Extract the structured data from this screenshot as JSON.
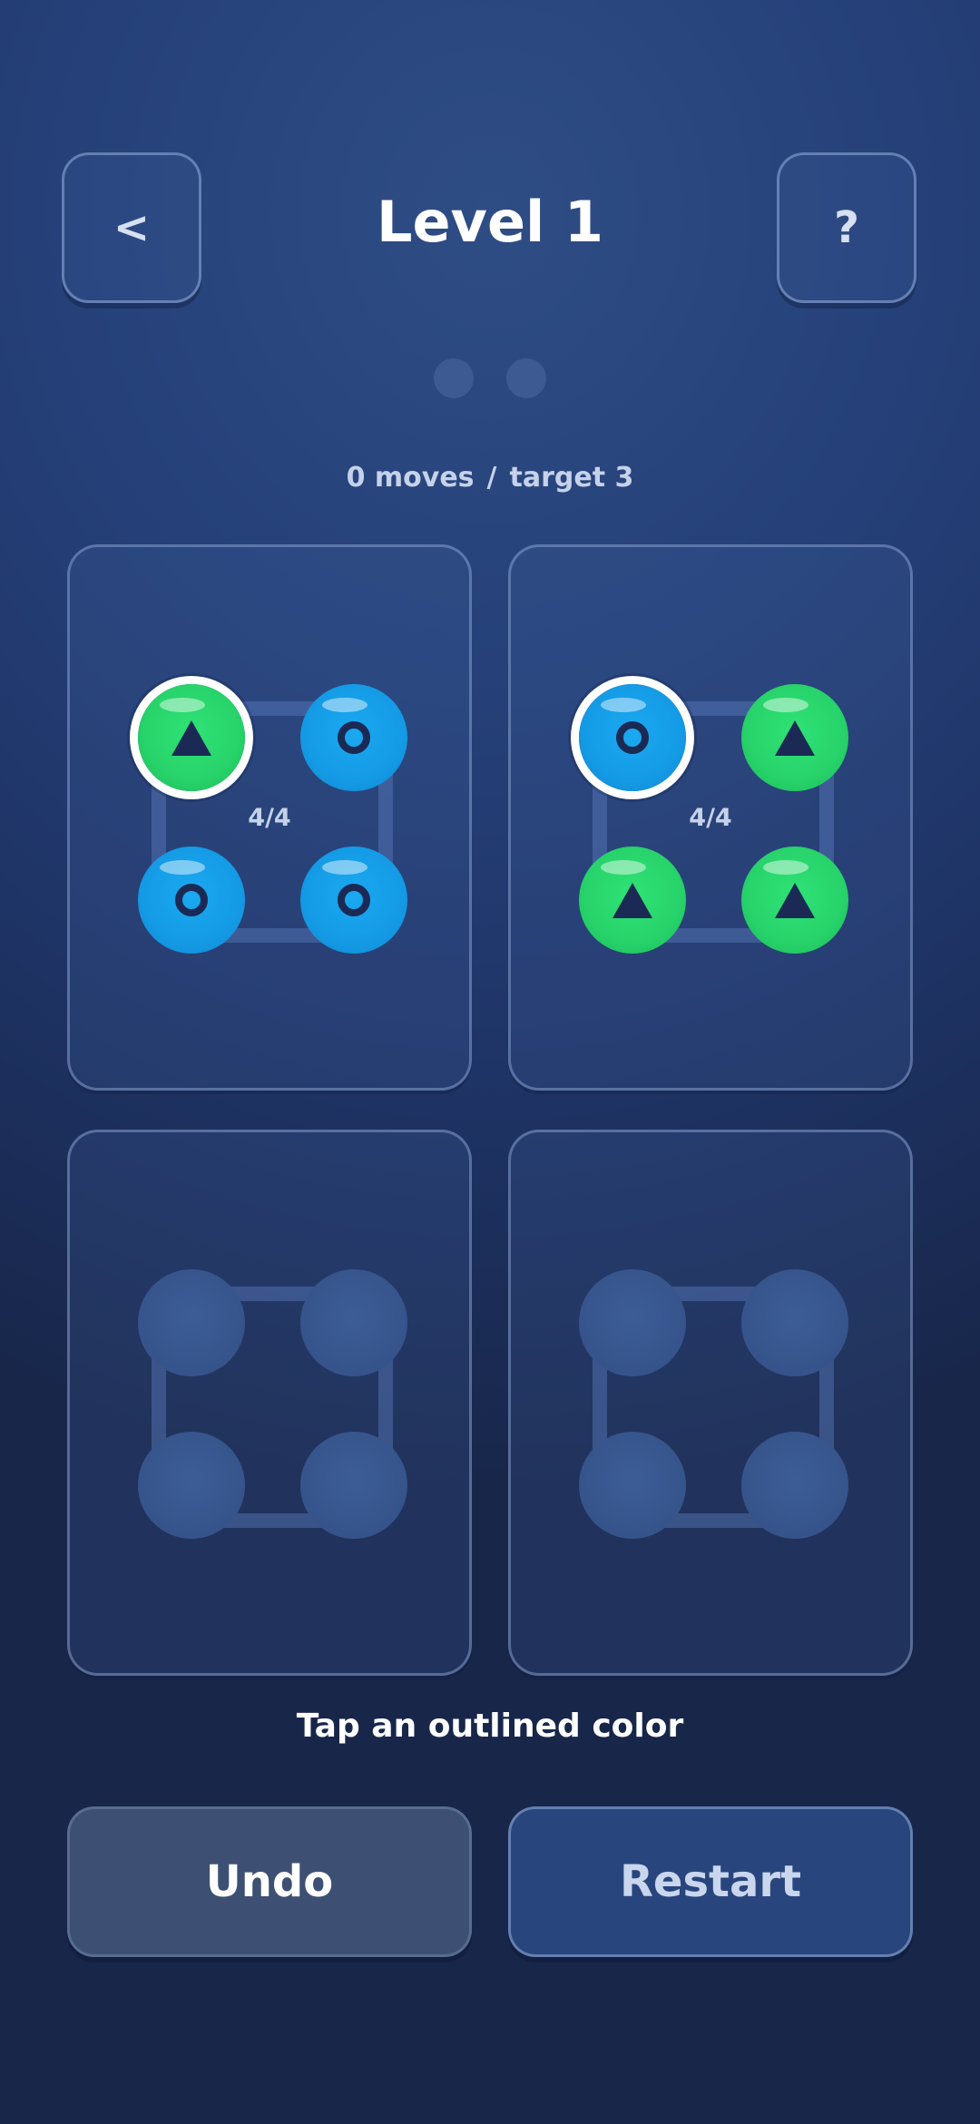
{
  "header": {
    "back_label": "<",
    "title": "Level 1",
    "help_label": "?"
  },
  "level_dots": 2,
  "status": {
    "moves": "0 moves",
    "separator": "/",
    "target": "target 3"
  },
  "colors": {
    "blue": "#159be6",
    "green": "#27d36a",
    "empty": "#36548b",
    "shape": "#1b2a55"
  },
  "tubes": [
    {
      "count": "4/4",
      "balls": [
        {
          "color": "green",
          "icon": "triangle-icon",
          "selected": true
        },
        {
          "color": "blue",
          "icon": "ring-icon",
          "selected": false
        },
        {
          "color": "blue",
          "icon": "ring-icon",
          "selected": false
        },
        {
          "color": "blue",
          "icon": "ring-icon",
          "selected": false
        }
      ]
    },
    {
      "count": "4/4",
      "balls": [
        {
          "color": "blue",
          "icon": "ring-icon",
          "selected": true
        },
        {
          "color": "green",
          "icon": "triangle-icon",
          "selected": false
        },
        {
          "color": "green",
          "icon": "triangle-icon",
          "selected": false
        },
        {
          "color": "green",
          "icon": "triangle-icon",
          "selected": false
        }
      ]
    },
    {
      "count": "",
      "balls": [
        {
          "color": "empty"
        },
        {
          "color": "empty"
        },
        {
          "color": "empty"
        },
        {
          "color": "empty"
        }
      ]
    },
    {
      "count": "",
      "balls": [
        {
          "color": "empty"
        },
        {
          "color": "empty"
        },
        {
          "color": "empty"
        },
        {
          "color": "empty"
        }
      ]
    }
  ],
  "hint": "Tap an outlined color",
  "actions": {
    "undo_label": "Undo",
    "restart_label": "Restart"
  }
}
